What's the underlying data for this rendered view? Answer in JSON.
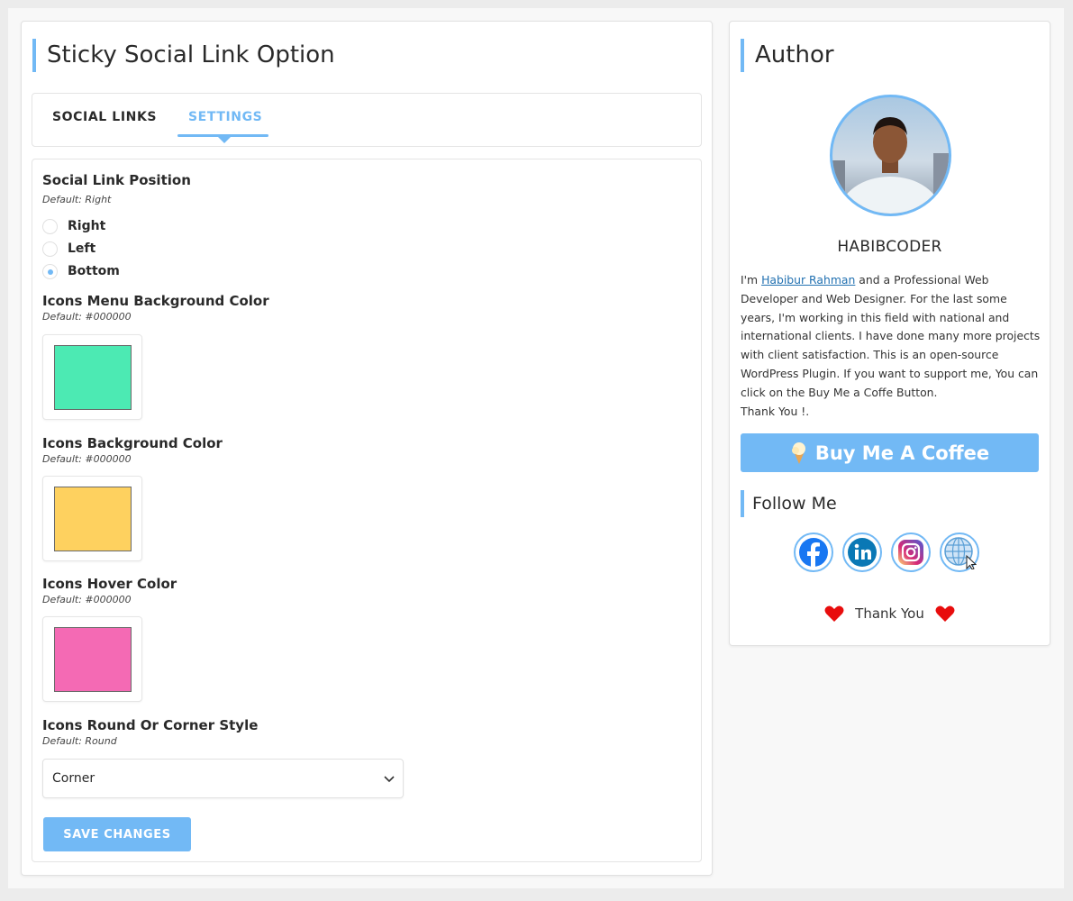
{
  "main": {
    "title": "Sticky Social Link Option",
    "tabs": [
      {
        "label": "SOCIAL LINKS",
        "active": false
      },
      {
        "label": "SETTINGS",
        "active": true
      }
    ],
    "position": {
      "title": "Social Link Position",
      "default": "Default: Right",
      "options": [
        {
          "label": "Right",
          "checked": false
        },
        {
          "label": "Left",
          "checked": false
        },
        {
          "label": "Bottom",
          "checked": true
        }
      ]
    },
    "menu_bg": {
      "title": "Icons Menu Background Color",
      "default": "Default: #000000",
      "color": "#4ceab3"
    },
    "icon_bg": {
      "title": "Icons Background Color",
      "default": "Default: #000000",
      "color": "#fed15f"
    },
    "hover": {
      "title": "Icons Hover Color",
      "default": "Default: #000000",
      "color": "#f46ab4"
    },
    "style": {
      "title": "Icons Round Or Corner Style",
      "default": "Default: Round",
      "selected": "Corner"
    },
    "save_label": "SAVE CHANGES"
  },
  "author": {
    "title": "Author",
    "name": "HABIBCODER",
    "bio_prefix": "I'm ",
    "bio_link": "Habibur Rahman",
    "bio_rest": " and a Professional Web Developer and Web Designer. For the last some years, I'm working in this field with national and international clients. I have done many more projects with client satisfaction. This is an open-source WordPress Plugin. If you want to support me, You can click on the Buy Me a Coffe Button.",
    "bio_thanks": "Thank You !.",
    "coffee_label": "Buy Me A Coffee",
    "follow_title": "Follow Me",
    "social": [
      "facebook-icon",
      "linkedin-icon",
      "instagram-icon",
      "website-globe-icon"
    ],
    "thanks": "Thank You"
  },
  "colors": {
    "accent": "#72b9f5"
  }
}
